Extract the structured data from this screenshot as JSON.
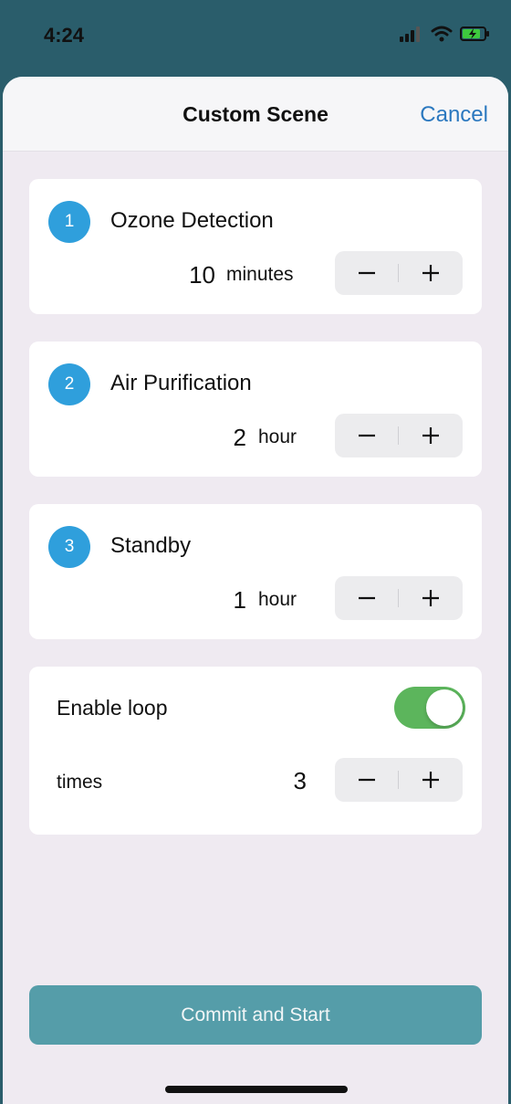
{
  "status": {
    "time": "4:24"
  },
  "nav": {
    "title": "Custom Scene",
    "cancel_label": "Cancel"
  },
  "steps": [
    {
      "number": "1",
      "title": "Ozone Detection",
      "value": "10",
      "unit": "minutes"
    },
    {
      "number": "2",
      "title": "Air Purification",
      "value": "2",
      "unit": "hour"
    },
    {
      "number": "3",
      "title": "Standby",
      "value": "1",
      "unit": "hour"
    }
  ],
  "loop": {
    "label": "Enable loop",
    "enabled": true,
    "times_label": "times",
    "times_value": "3"
  },
  "commit": {
    "label": "Commit and Start"
  },
  "colors": {
    "accent_blue": "#2f9fdc",
    "toggle_green": "#5cb55c",
    "button_teal": "#559da9",
    "link_blue": "#2b78bf"
  },
  "icons": [
    "signal-icon",
    "wifi-icon",
    "battery-charging-icon",
    "minus-icon",
    "plus-icon"
  ]
}
